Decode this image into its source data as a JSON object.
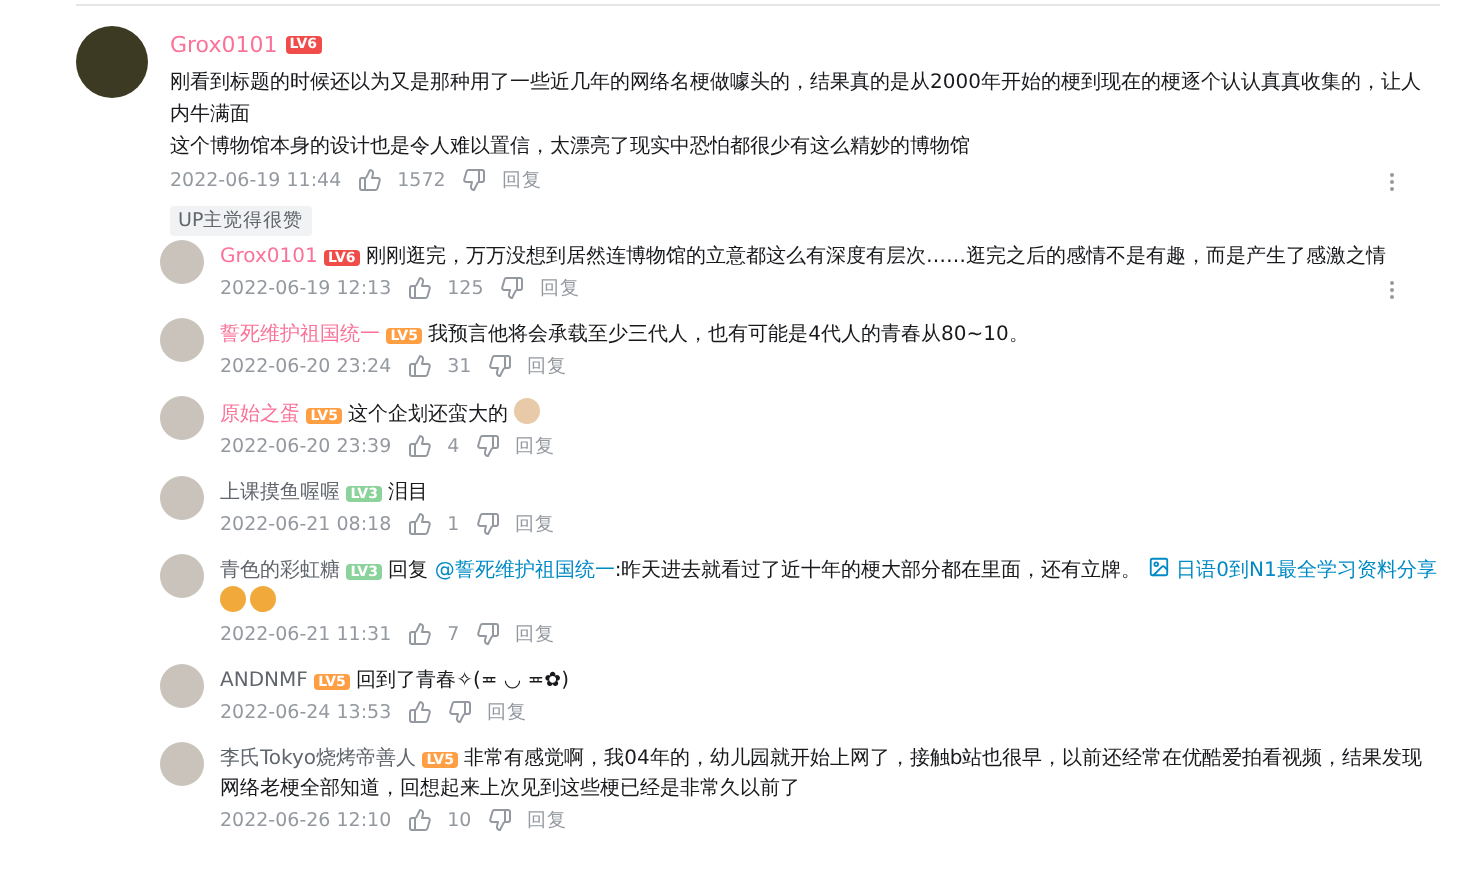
{
  "comment": {
    "user": "Grox0101",
    "level": "LV6",
    "vip": true,
    "paragraphs": [
      "刚看到标题的时候还以为又是那种用了一些近几年的网络名梗做噱头的，结果真的是从2000年开始的梗到现在的梗逐个认认真真收集的，让人内牛满面",
      "这个博物馆本身的设计也是令人难以置信，太漂亮了现实中恐怕都很少有这么精妙的博物馆"
    ],
    "date": "2022-06-19 11:44",
    "likes": "1572",
    "reply": "回复",
    "tag": "UP主觉得很赞",
    "menu": true
  },
  "replies": [
    {
      "user": "Grox0101",
      "level": "LV6",
      "vip": true,
      "text": "刚刚逛完，万万没想到居然连博物馆的立意都这么有深度有层次……逛完之后的感情不是有趣，而是产生了感激之情",
      "date": "2022-06-19 12:13",
      "likes": "125",
      "reply": "回复",
      "menu": true
    },
    {
      "user": "誓死维护祖国统一",
      "level": "LV5",
      "vip": true,
      "text": "我预言他将会承载至少三代人，也有可能是4代人的青春从80~10。",
      "date": "2022-06-20 23:24",
      "likes": "31",
      "reply": "回复",
      "menu": false
    },
    {
      "user": "原始之蛋",
      "level": "LV5",
      "vip": true,
      "text": "这个企划还蛮大的",
      "emojis": [
        {
          "kind": "sticker"
        }
      ],
      "date": "2022-06-20 23:39",
      "likes": "4",
      "reply": "回复",
      "menu": false
    },
    {
      "user": "上课摸鱼喔喔",
      "level": "LV3",
      "vip": false,
      "text": "泪目",
      "date": "2022-06-21 08:18",
      "likes": "1",
      "reply": "回复",
      "menu": false
    },
    {
      "user": "青色的彩虹糖",
      "level": "LV3",
      "vip": false,
      "reply_prefix": "回复",
      "mention": "@誓死维护祖国统一",
      "text": ":昨天进去就看过了近十年的梗大部分都在里面，还有立牌。",
      "link": "日语0到N1最全学习资料分享",
      "emojis": [
        {
          "kind": "smiley"
        },
        {
          "kind": "smiley"
        }
      ],
      "date": "2022-06-21 11:31",
      "likes": "7",
      "reply": "回复",
      "menu": false
    },
    {
      "user": "ANDNMF",
      "level": "LV5",
      "vip": false,
      "text": "回到了青春✧(≖ ◡ ≖✿)",
      "date": "2022-06-24 13:53",
      "reply": "回复",
      "menu": false
    },
    {
      "user": "李氏Tokyo烧烤帝善人",
      "level": "LV5",
      "vip": false,
      "text": "非常有感觉啊，我04年的，幼儿园就开始上网了，接触b站也很早，以前还经常在优酷爱拍看视频，结果发现网络老梗全部知道，回想起来上次见到这些梗已经是非常久以前了",
      "date": "2022-06-26 12:10",
      "likes": "10",
      "reply": "回复",
      "menu": false
    }
  ]
}
